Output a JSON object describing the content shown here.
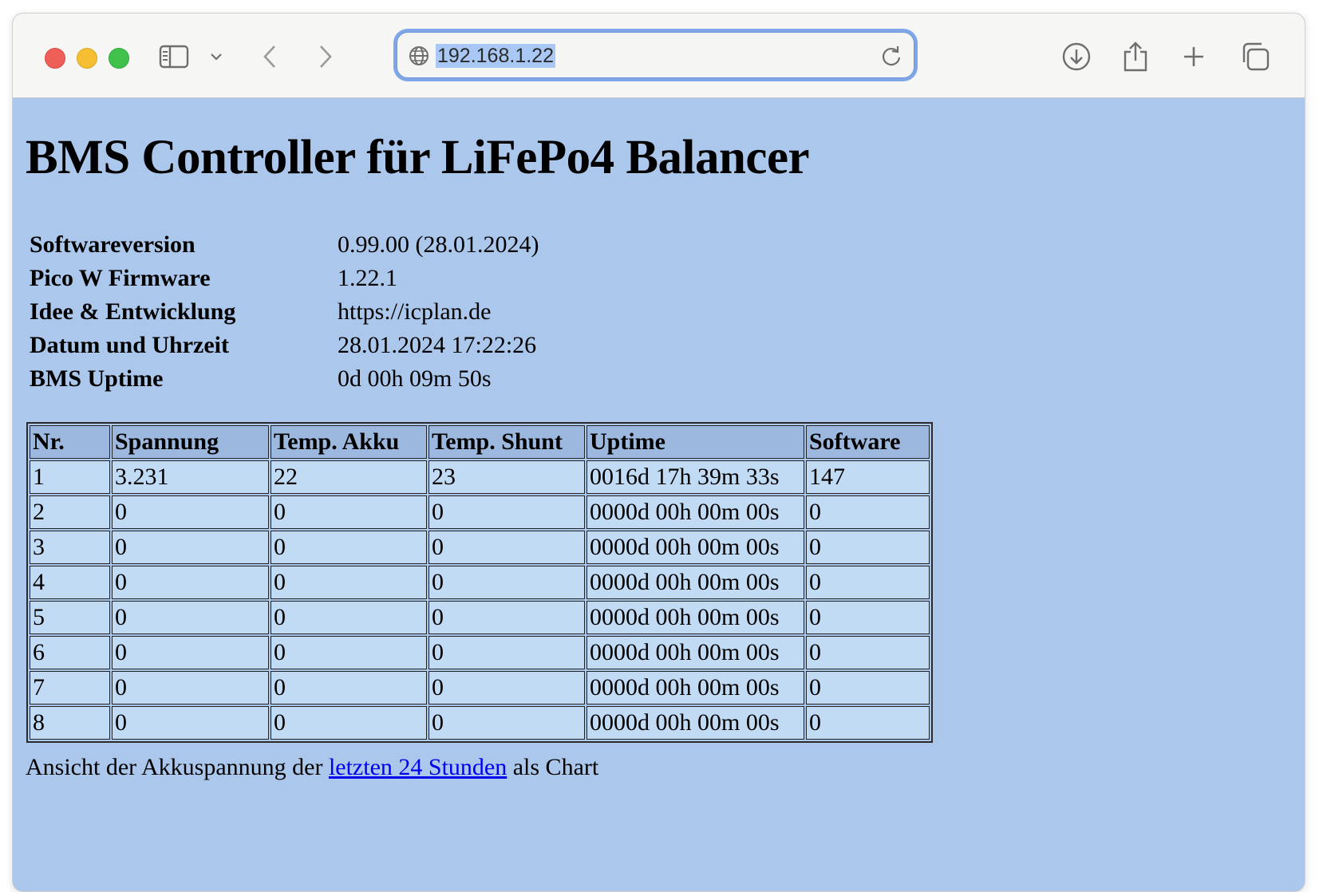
{
  "browser": {
    "url": "192.168.1.22"
  },
  "page": {
    "title": "BMS Controller für LiFePo4 Balancer",
    "info": [
      {
        "key": "Softwareversion",
        "value": "0.99.00 (28.01.2024)"
      },
      {
        "key": "Pico W Firmware",
        "value": "1.22.1"
      },
      {
        "key": "Idee & Entwicklung",
        "value": "https://icplan.de"
      },
      {
        "key": "Datum und Uhrzeit",
        "value": "28.01.2024 17:22:26"
      },
      {
        "key": "BMS Uptime",
        "value": "0d 00h 09m 50s"
      }
    ],
    "table": {
      "headers": [
        "Nr.",
        "Spannung",
        "Temp. Akku",
        "Temp. Shunt",
        "Uptime",
        "Software"
      ],
      "rows": [
        [
          "1",
          "3.231",
          "22",
          "23",
          "0016d 17h 39m 33s",
          "147"
        ],
        [
          "2",
          "0",
          "0",
          "0",
          "0000d 00h 00m 00s",
          "0"
        ],
        [
          "3",
          "0",
          "0",
          "0",
          "0000d 00h 00m 00s",
          "0"
        ],
        [
          "4",
          "0",
          "0",
          "0",
          "0000d 00h 00m 00s",
          "0"
        ],
        [
          "5",
          "0",
          "0",
          "0",
          "0000d 00h 00m 00s",
          "0"
        ],
        [
          "6",
          "0",
          "0",
          "0",
          "0000d 00h 00m 00s",
          "0"
        ],
        [
          "7",
          "0",
          "0",
          "0",
          "0000d 00h 00m 00s",
          "0"
        ],
        [
          "8",
          "0",
          "0",
          "0",
          "0000d 00h 00m 00s",
          "0"
        ]
      ]
    },
    "footer": {
      "before": "Ansicht der Akkuspannung der",
      "link": "letzten 24 Stunden",
      "after": "als Chart"
    }
  }
}
